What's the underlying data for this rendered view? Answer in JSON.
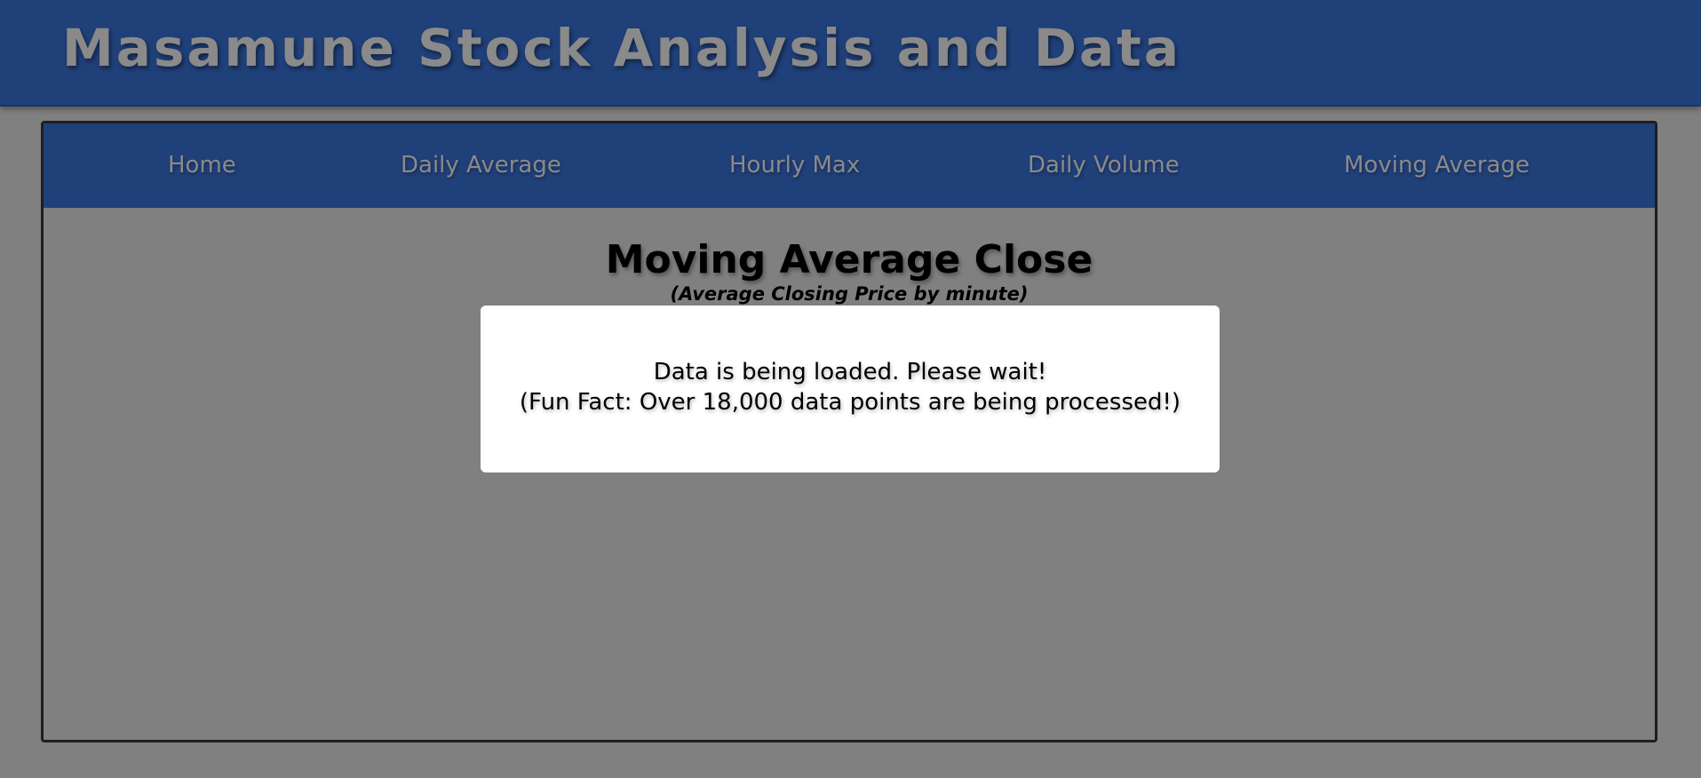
{
  "header": {
    "title": "Masamune Stock Analysis and Data"
  },
  "nav": {
    "items": [
      {
        "label": "Home"
      },
      {
        "label": "Daily Average"
      },
      {
        "label": "Hourly Max"
      },
      {
        "label": "Daily Volume"
      },
      {
        "label": "Moving Average"
      }
    ]
  },
  "main": {
    "title": "Moving Average Close",
    "subtitle": "(Average Closing Price by minute)"
  },
  "loading_modal": {
    "line1": "Data is being loaded. Please wait!",
    "line2": "(Fun Fact: Over 18,000 data points are being processed!)"
  },
  "colors": {
    "header_bg": "#20407a",
    "page_bg": "#808080",
    "nav_text": "#8a8a8a",
    "modal_bg": "#ffffff"
  }
}
